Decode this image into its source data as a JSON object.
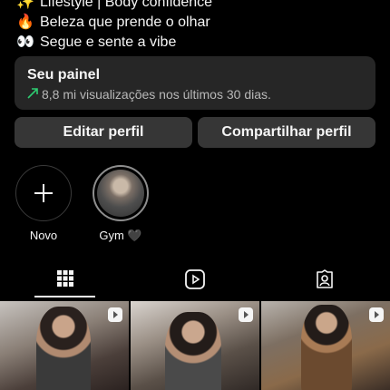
{
  "bio": {
    "lines": [
      {
        "icon": "sparkles-icon",
        "glyph": "✨",
        "text": "Lifestyle | Body confidence"
      },
      {
        "icon": "fire-icon",
        "glyph": "🔥",
        "text": "Beleza que prende o olhar"
      },
      {
        "icon": "eyes-icon",
        "glyph": "👀",
        "text": "Segue e sente a vibe"
      }
    ]
  },
  "dashboard": {
    "title": "Seu painel",
    "subtitle": "8,8 mi visualizações nos últimos 30 dias.",
    "trend_icon": "trending-up-icon",
    "trend_color": "#2ecc71"
  },
  "buttons": {
    "edit_label": "Editar perfil",
    "share_label": "Compartilhar perfil"
  },
  "highlights": [
    {
      "label": "Novo",
      "icon": "plus-icon"
    },
    {
      "label": "Gym 🖤",
      "icon": "highlight-cover"
    }
  ],
  "tabs": [
    {
      "name": "grid",
      "icon": "grid-icon",
      "active": true
    },
    {
      "name": "reels",
      "icon": "reels-icon",
      "active": false
    },
    {
      "name": "tagged",
      "icon": "tagged-person-icon",
      "active": false
    }
  ],
  "posts": [
    {
      "type": "reel",
      "icon": "reel-badge-icon"
    },
    {
      "type": "reel",
      "icon": "reel-badge-icon"
    },
    {
      "type": "reel",
      "icon": "reel-badge-icon"
    }
  ],
  "colors": {
    "background": "#000000",
    "surface": "#262626",
    "button": "#363636",
    "text": "#f5f5f5"
  }
}
